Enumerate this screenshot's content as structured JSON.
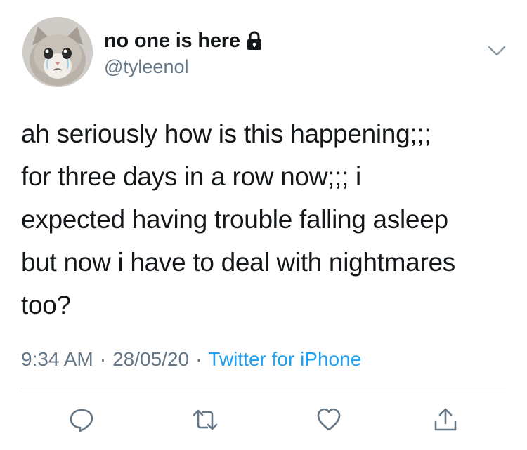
{
  "user": {
    "display_name": "no one is here",
    "handle": "@tyleenol",
    "avatar_icon": "crying-cat-avatar",
    "protected_icon": "lock-icon"
  },
  "tweet": {
    "lines": [
      "ah seriously how is this happening;;;",
      "for three days in a row now;;; i",
      "expected having trouble falling asleep",
      "but now i have to deal with nightmares",
      "too?"
    ]
  },
  "meta": {
    "time": "9:34 AM",
    "date": "28/05/20",
    "separator": "·",
    "source": "Twitter for iPhone"
  },
  "actions": {
    "reply_icon": "reply-icon",
    "retweet_icon": "retweet-icon",
    "like_icon": "heart-icon",
    "share_icon": "share-icon",
    "menu_icon": "chevron-down-icon"
  },
  "colors": {
    "text": "#14171a",
    "secondary": "#657786",
    "link": "#1da1f2",
    "divider": "#e1e8ed"
  }
}
